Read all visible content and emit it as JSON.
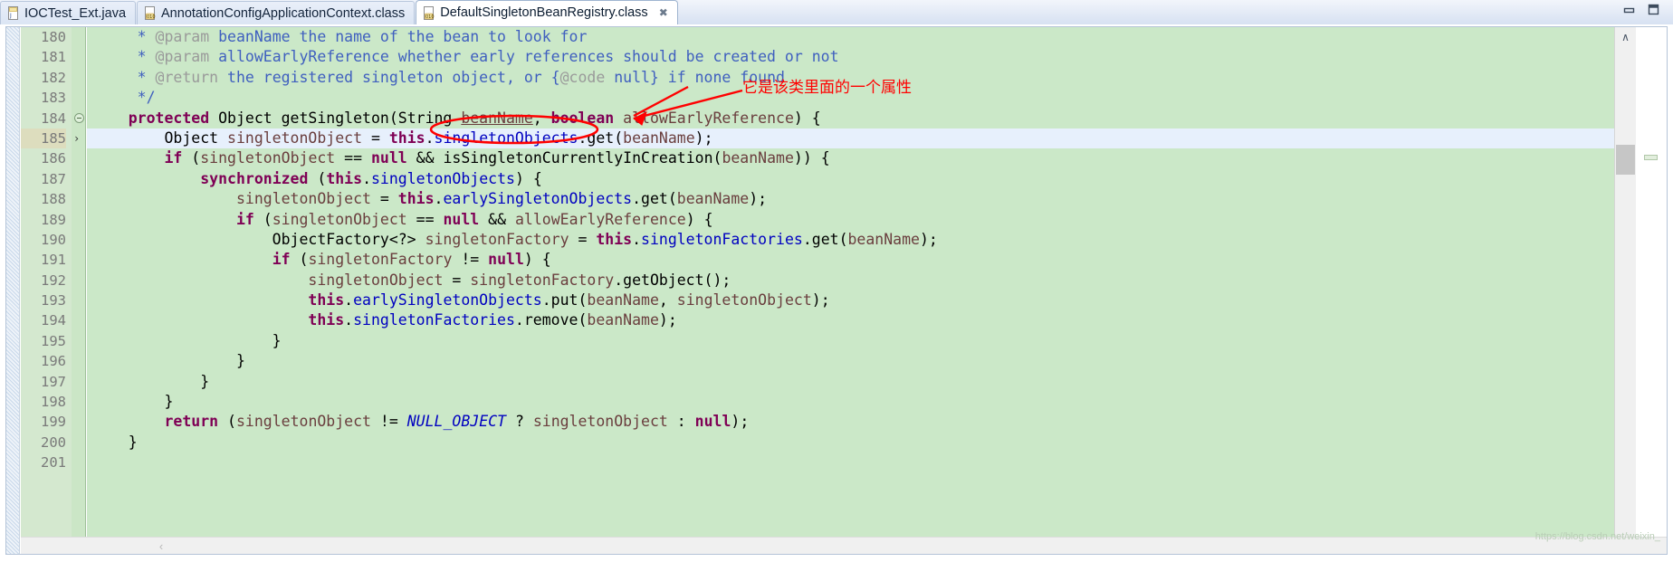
{
  "window": {
    "minimize_label": "—",
    "restore_label": "❐"
  },
  "tabs": [
    {
      "label": "IOCTest_Ext.java",
      "icon": "java-file-icon",
      "active": false,
      "closable": false
    },
    {
      "label": "AnnotationConfigApplicationContext.class",
      "icon": "class-file-icon",
      "active": false,
      "closable": false
    },
    {
      "label": "DefaultSingletonBeanRegistry.class",
      "icon": "class-file-icon",
      "active": true,
      "closable": true,
      "close_glyph": "✖"
    }
  ],
  "editor": {
    "line_numbers": [
      "180",
      "181",
      "182",
      "183",
      "184",
      "185",
      "186",
      "187",
      "188",
      "189",
      "190",
      "191",
      "192",
      "193",
      "194",
      "195",
      "196",
      "197",
      "198",
      "199",
      "200",
      "201"
    ],
    "current_line_number": "185",
    "lines": [
      {
        "n": "180",
        "tokens": [
          {
            "t": "     * ",
            "c": "cmt"
          },
          {
            "t": "@param",
            "c": "cmt-tag"
          },
          {
            "t": " beanName the name of the bean to look for",
            "c": "cmt"
          }
        ]
      },
      {
        "n": "181",
        "tokens": [
          {
            "t": "     * ",
            "c": "cmt"
          },
          {
            "t": "@param",
            "c": "cmt-tag"
          },
          {
            "t": " allowEarlyReference whether early references should be created or not",
            "c": "cmt"
          }
        ]
      },
      {
        "n": "182",
        "tokens": [
          {
            "t": "     * ",
            "c": "cmt"
          },
          {
            "t": "@return",
            "c": "cmt-tag"
          },
          {
            "t": " the registered singleton object, or {",
            "c": "cmt"
          },
          {
            "t": "@code",
            "c": "cmt-tag"
          },
          {
            "t": " null} if none found",
            "c": "cmt"
          }
        ]
      },
      {
        "n": "183",
        "tokens": [
          {
            "t": "     */",
            "c": "cmt"
          }
        ]
      },
      {
        "n": "184",
        "tokens": [
          {
            "t": "    ",
            "c": "plain"
          },
          {
            "t": "protected",
            "c": "kw"
          },
          {
            "t": " Object getSingleton(String ",
            "c": "plain"
          },
          {
            "t": "beanName",
            "c": "param-u"
          },
          {
            "t": ", ",
            "c": "plain"
          },
          {
            "t": "boolean",
            "c": "kw"
          },
          {
            "t": " ",
            "c": "plain"
          },
          {
            "t": "allowEarlyReference",
            "c": "param"
          },
          {
            "t": ") {",
            "c": "plain"
          }
        ]
      },
      {
        "n": "185",
        "tokens": [
          {
            "t": "        Object ",
            "c": "plain"
          },
          {
            "t": "singletonObject",
            "c": "param"
          },
          {
            "t": " = ",
            "c": "plain"
          },
          {
            "t": "this",
            "c": "kw"
          },
          {
            "t": ".",
            "c": "plain"
          },
          {
            "t": "singletonObjects",
            "c": "fld"
          },
          {
            "t": ".get(",
            "c": "plain"
          },
          {
            "t": "beanName",
            "c": "param"
          },
          {
            "t": ");",
            "c": "plain"
          }
        ]
      },
      {
        "n": "186",
        "tokens": [
          {
            "t": "        ",
            "c": "plain"
          },
          {
            "t": "if",
            "c": "kw"
          },
          {
            "t": " (",
            "c": "plain"
          },
          {
            "t": "singletonObject",
            "c": "param"
          },
          {
            "t": " == ",
            "c": "plain"
          },
          {
            "t": "null",
            "c": "kw"
          },
          {
            "t": " && isSingletonCurrentlyInCreation(",
            "c": "plain"
          },
          {
            "t": "beanName",
            "c": "param"
          },
          {
            "t": ")) {",
            "c": "plain"
          }
        ]
      },
      {
        "n": "187",
        "tokens": [
          {
            "t": "            ",
            "c": "plain"
          },
          {
            "t": "synchronized",
            "c": "kw"
          },
          {
            "t": " (",
            "c": "plain"
          },
          {
            "t": "this",
            "c": "kw"
          },
          {
            "t": ".",
            "c": "plain"
          },
          {
            "t": "singletonObjects",
            "c": "fld"
          },
          {
            "t": ") {",
            "c": "plain"
          }
        ]
      },
      {
        "n": "188",
        "tokens": [
          {
            "t": "                ",
            "c": "plain"
          },
          {
            "t": "singletonObject",
            "c": "param"
          },
          {
            "t": " = ",
            "c": "plain"
          },
          {
            "t": "this",
            "c": "kw"
          },
          {
            "t": ".",
            "c": "plain"
          },
          {
            "t": "earlySingletonObjects",
            "c": "fld"
          },
          {
            "t": ".get(",
            "c": "plain"
          },
          {
            "t": "beanName",
            "c": "param"
          },
          {
            "t": ");",
            "c": "plain"
          }
        ]
      },
      {
        "n": "189",
        "tokens": [
          {
            "t": "                ",
            "c": "plain"
          },
          {
            "t": "if",
            "c": "kw"
          },
          {
            "t": " (",
            "c": "plain"
          },
          {
            "t": "singletonObject",
            "c": "param"
          },
          {
            "t": " == ",
            "c": "plain"
          },
          {
            "t": "null",
            "c": "kw"
          },
          {
            "t": " && ",
            "c": "plain"
          },
          {
            "t": "allowEarlyReference",
            "c": "param"
          },
          {
            "t": ") {",
            "c": "plain"
          }
        ]
      },
      {
        "n": "190",
        "tokens": [
          {
            "t": "                    ObjectFactory<?> ",
            "c": "plain"
          },
          {
            "t": "singletonFactory",
            "c": "param"
          },
          {
            "t": " = ",
            "c": "plain"
          },
          {
            "t": "this",
            "c": "kw"
          },
          {
            "t": ".",
            "c": "plain"
          },
          {
            "t": "singletonFactories",
            "c": "fld"
          },
          {
            "t": ".get(",
            "c": "plain"
          },
          {
            "t": "beanName",
            "c": "param"
          },
          {
            "t": ");",
            "c": "plain"
          }
        ]
      },
      {
        "n": "191",
        "tokens": [
          {
            "t": "                    ",
            "c": "plain"
          },
          {
            "t": "if",
            "c": "kw"
          },
          {
            "t": " (",
            "c": "plain"
          },
          {
            "t": "singletonFactory",
            "c": "param"
          },
          {
            "t": " != ",
            "c": "plain"
          },
          {
            "t": "null",
            "c": "kw"
          },
          {
            "t": ") {",
            "c": "plain"
          }
        ]
      },
      {
        "n": "192",
        "tokens": [
          {
            "t": "                        ",
            "c": "plain"
          },
          {
            "t": "singletonObject",
            "c": "param"
          },
          {
            "t": " = ",
            "c": "plain"
          },
          {
            "t": "singletonFactory",
            "c": "param"
          },
          {
            "t": ".getObject();",
            "c": "plain"
          }
        ]
      },
      {
        "n": "193",
        "tokens": [
          {
            "t": "                        ",
            "c": "plain"
          },
          {
            "t": "this",
            "c": "kw"
          },
          {
            "t": ".",
            "c": "plain"
          },
          {
            "t": "earlySingletonObjects",
            "c": "fld"
          },
          {
            "t": ".put(",
            "c": "plain"
          },
          {
            "t": "beanName",
            "c": "param"
          },
          {
            "t": ", ",
            "c": "plain"
          },
          {
            "t": "singletonObject",
            "c": "param"
          },
          {
            "t": ");",
            "c": "plain"
          }
        ]
      },
      {
        "n": "194",
        "tokens": [
          {
            "t": "                        ",
            "c": "plain"
          },
          {
            "t": "this",
            "c": "kw"
          },
          {
            "t": ".",
            "c": "plain"
          },
          {
            "t": "singletonFactories",
            "c": "fld"
          },
          {
            "t": ".remove(",
            "c": "plain"
          },
          {
            "t": "beanName",
            "c": "param"
          },
          {
            "t": ");",
            "c": "plain"
          }
        ]
      },
      {
        "n": "195",
        "tokens": [
          {
            "t": "                    }",
            "c": "plain"
          }
        ]
      },
      {
        "n": "196",
        "tokens": [
          {
            "t": "                }",
            "c": "plain"
          }
        ]
      },
      {
        "n": "197",
        "tokens": [
          {
            "t": "            }",
            "c": "plain"
          }
        ]
      },
      {
        "n": "198",
        "tokens": [
          {
            "t": "        }",
            "c": "plain"
          }
        ]
      },
      {
        "n": "199",
        "tokens": [
          {
            "t": "        ",
            "c": "plain"
          },
          {
            "t": "return",
            "c": "kw"
          },
          {
            "t": " (",
            "c": "plain"
          },
          {
            "t": "singletonObject",
            "c": "param"
          },
          {
            "t": " != ",
            "c": "plain"
          },
          {
            "t": "NULL_OBJECT",
            "c": "stat"
          },
          {
            "t": " ? ",
            "c": "plain"
          },
          {
            "t": "singletonObject",
            "c": "param"
          },
          {
            "t": " : ",
            "c": "plain"
          },
          {
            "t": "null",
            "c": "kw"
          },
          {
            "t": ");",
            "c": "plain"
          }
        ]
      },
      {
        "n": "200",
        "tokens": [
          {
            "t": "    }",
            "c": "plain"
          }
        ]
      },
      {
        "n": "201",
        "tokens": [
          {
            "t": "",
            "c": "plain"
          }
        ]
      }
    ]
  },
  "annotation": {
    "text": "它是该类里面的一个属性",
    "color": "#ff0000",
    "shapes": [
      "oval-around-singletonObjects",
      "arrow-to-oval"
    ]
  },
  "scrollbars": {
    "vertical_up_glyph": "∧",
    "vertical_down_glyph": "∨",
    "horizontal_left_glyph": "‹"
  },
  "watermark": "https://blog.csdn.net/weixin_",
  "colors": {
    "code_background": "#cbe8c8",
    "current_line": "#e7f0fc",
    "gutter_background": "#d4e8cf",
    "keyword": "#7f0055",
    "comment": "#3f5fbf",
    "field": "#0000c0",
    "parameter": "#6a3e3e",
    "annotation_red": "#ff0000"
  }
}
